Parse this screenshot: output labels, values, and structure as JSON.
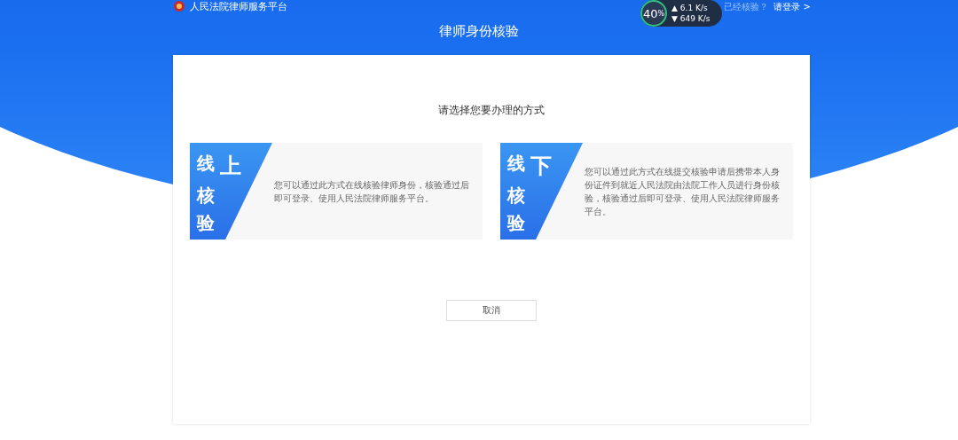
{
  "header": {
    "site_name": "人民法院律师服务平台",
    "login_prompt": "已经核验？",
    "login_link": "请登录",
    "login_arrow": ">"
  },
  "speed_widget": {
    "percent": "40",
    "percent_unit": "%",
    "upload_mark": "▲",
    "download_mark": "▼",
    "upload": "6.1",
    "upload_unit": "K/s",
    "download": "649",
    "download_unit": "K/s"
  },
  "page_title": "律师身份核验",
  "prompt": "请选择您要办理的方式",
  "options": [
    {
      "title": "线上核验",
      "description": "您可以通过此方式在线核验律师身份，核验通过后即可登录、使用人民法院律师服务平台。"
    },
    {
      "title": "线下核验",
      "description": "您可以通过此方式在线提交核验申请后携带本人身份证件到就近人民法院由法院工作人员进行身份核验，核验通过后即可登录、使用人民法院律师服务平台。"
    }
  ],
  "cancel_button": "取消"
}
